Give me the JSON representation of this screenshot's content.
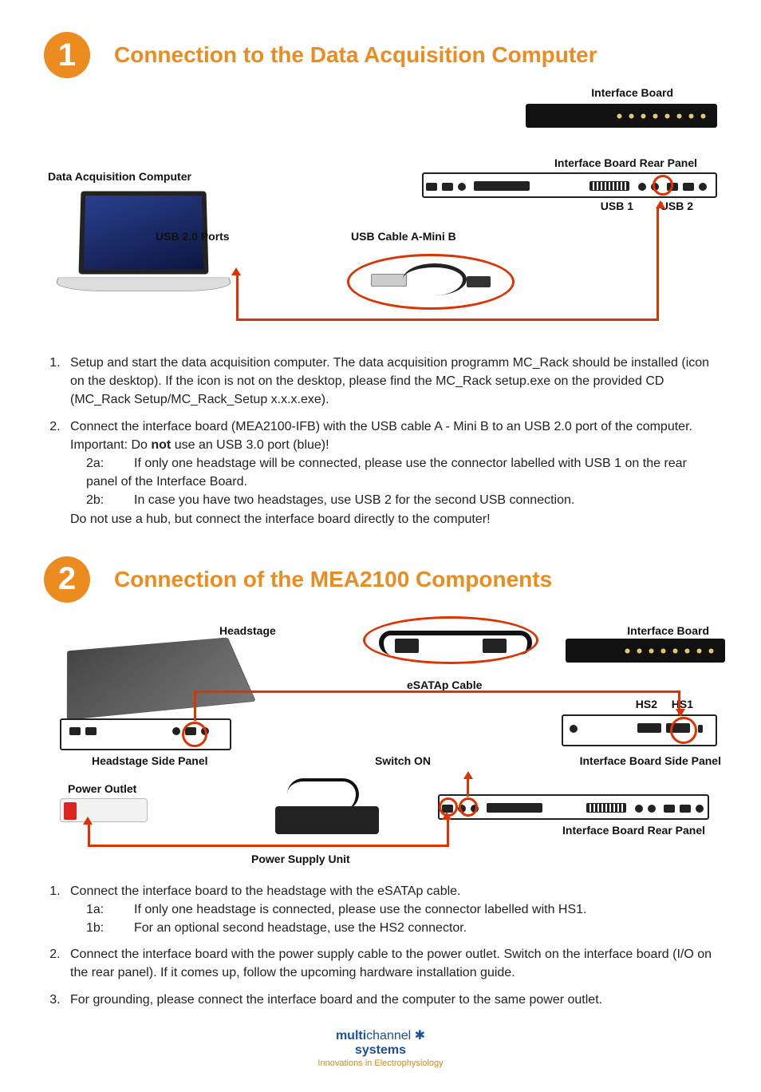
{
  "section1": {
    "number": "1",
    "title": "Connection to the Data Acquisition Computer",
    "labels": {
      "interface_board": "Interface Board",
      "interface_board_rear": "Interface Board Rear Panel",
      "data_acq_computer": "Data Acquisition Computer",
      "usb_ports": "USB 2.0 Ports",
      "usb_cable": "USB Cable A-Mini B",
      "usb1": "USB 1",
      "usb2": "USB 2"
    },
    "steps": [
      {
        "text": "Setup and start the data acquisition computer. The data acquisition programm MC_Rack should be installed (icon on the desktop). If the icon is not on the desktop, please find the MC_Rack setup.exe on the provided CD (MC_Rack Setup/MC_Rack_Setup x.x.x.exe)."
      },
      {
        "text_before": "Connect the interface board (MEA2100-IFB) with the USB cable A - Mini B to an USB 2.0 port of the computer. Important: Do ",
        "bold": "not",
        "text_after": " use an USB 3.0 port (blue)!",
        "subs": [
          {
            "tag": "2a:",
            "text": "If only one headstage will be connected, please use the connector labelled with USB 1 on the rear panel of the Interface Board."
          },
          {
            "tag": "2b:",
            "text": "In case you have two headstages, use USB 2 for the second USB connection."
          }
        ],
        "trailing": "Do not use a hub, but connect the interface board directly to the computer!"
      }
    ]
  },
  "section2": {
    "number": "2",
    "title": "Connection of the MEA2100 Components",
    "labels": {
      "headstage": "Headstage",
      "interface_board": "Interface Board",
      "esatap": "eSATAp Cable",
      "headstage_side": "Headstage Side Panel",
      "switch_on": "Switch ON",
      "ifb_side": "Interface Board Side Panel",
      "hs1": "HS1",
      "hs2": "HS2",
      "power_outlet": "Power Outlet",
      "ifb_rear": "Interface Board Rear Panel",
      "psu": "Power Supply Unit"
    },
    "steps": [
      {
        "text": "Connect the interface board to the headstage with the eSATAp cable.",
        "subs": [
          {
            "tag": "1a:",
            "text": "If only one headstage is connected,  please use the connector labelled with HS1."
          },
          {
            "tag": "1b:",
            "text": "For an optional second headstage, use the HS2 connector."
          }
        ]
      },
      {
        "text": "Connect the interface board with the power supply cable to the power outlet. Switch on the interface board (I/O on the rear panel). If it comes up, follow the upcoming hardware installation guide."
      },
      {
        "text": "For grounding, please connect the interface board and the computer to the same power outlet."
      }
    ]
  },
  "footer": {
    "brand_bold": "multi",
    "brand_rest": "channel",
    "line2": "systems",
    "tagline": "Innovations in Electrophysiology"
  }
}
